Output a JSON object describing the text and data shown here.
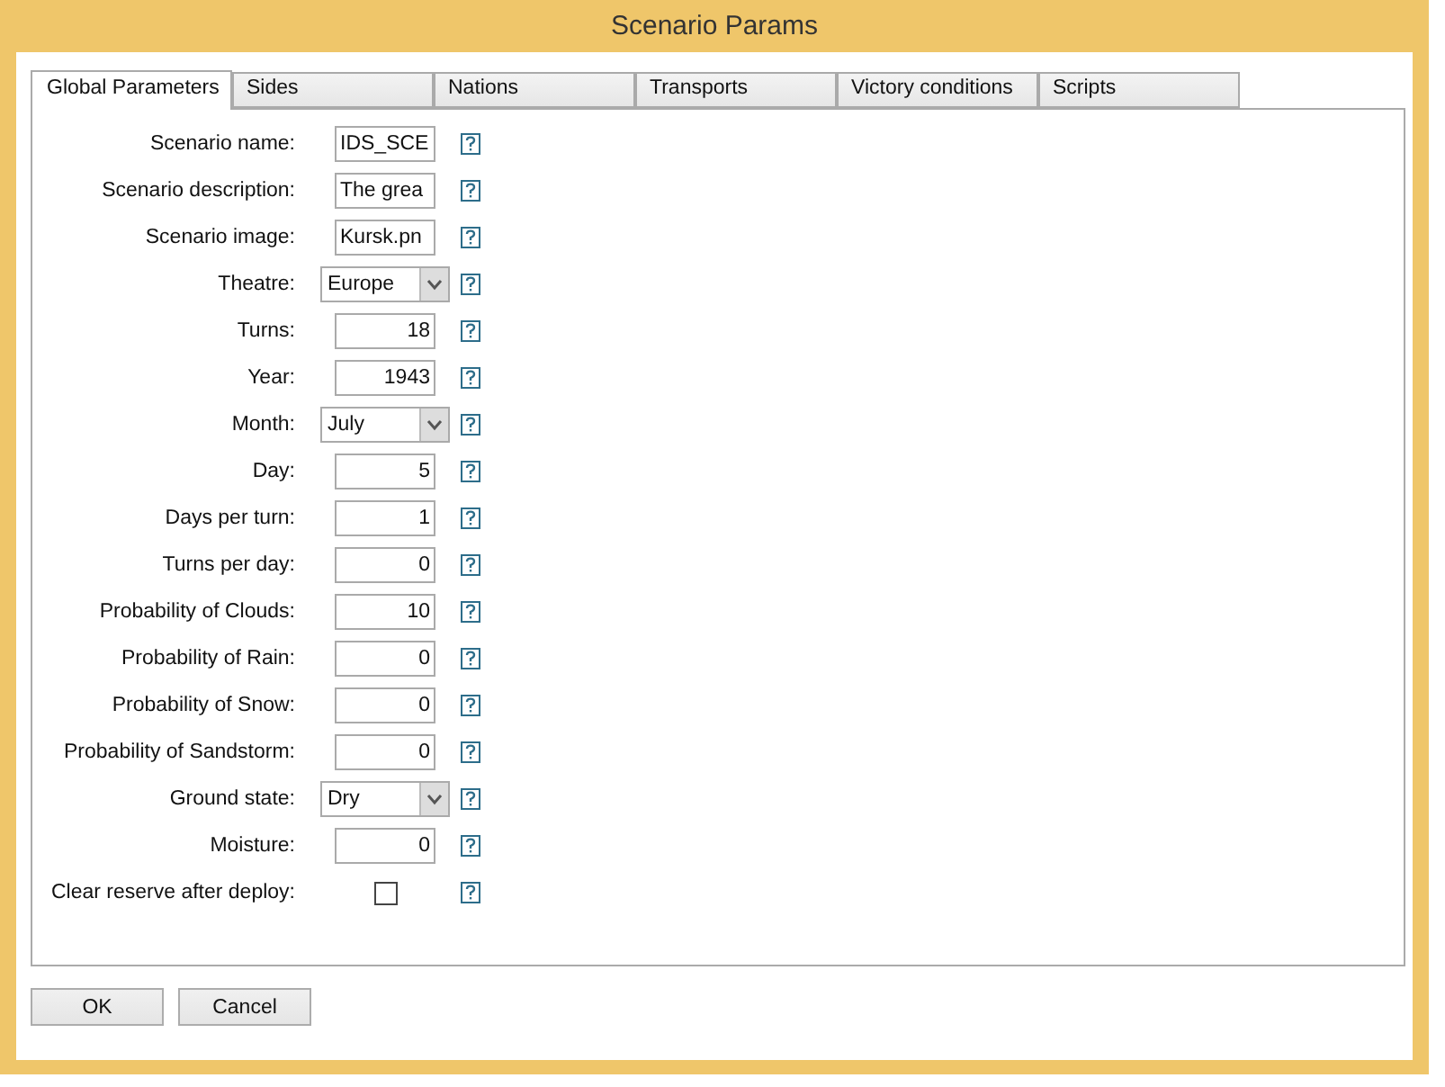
{
  "window": {
    "title": "Scenario Params"
  },
  "tabs": [
    {
      "label": "Global Parameters",
      "selected": true
    },
    {
      "label": "Sides",
      "selected": false
    },
    {
      "label": "Nations",
      "selected": false
    },
    {
      "label": "Transports",
      "selected": false
    },
    {
      "label": "Victory conditions",
      "selected": false
    },
    {
      "label": "Scripts",
      "selected": false
    }
  ],
  "fields": [
    {
      "label": "Scenario name:",
      "kind": "text",
      "value": "IDS_SCE"
    },
    {
      "label": "Scenario description:",
      "kind": "text",
      "value": "The grea"
    },
    {
      "label": "Scenario image:",
      "kind": "text",
      "value": "Kursk.pn"
    },
    {
      "label": "Theatre:",
      "kind": "select",
      "value": "Europe"
    },
    {
      "label": "Turns:",
      "kind": "number",
      "value": "18"
    },
    {
      "label": "Year:",
      "kind": "number",
      "value": "1943"
    },
    {
      "label": "Month:",
      "kind": "select",
      "value": "July"
    },
    {
      "label": "Day:",
      "kind": "number",
      "value": "5"
    },
    {
      "label": "Days per turn:",
      "kind": "number",
      "value": "1"
    },
    {
      "label": "Turns per day:",
      "kind": "number",
      "value": "0"
    },
    {
      "label": "Probability of Clouds:",
      "kind": "number",
      "value": "10"
    },
    {
      "label": "Probability of Rain:",
      "kind": "number",
      "value": "0"
    },
    {
      "label": "Probability of Snow:",
      "kind": "number",
      "value": "0"
    },
    {
      "label": "Probability of Sandstorm:",
      "kind": "number",
      "value": "0"
    },
    {
      "label": "Ground state:",
      "kind": "select",
      "value": "Dry"
    },
    {
      "label": "Moisture:",
      "kind": "number",
      "value": "0"
    },
    {
      "label": "Clear reserve after deploy:",
      "kind": "checkbox",
      "checked": false
    }
  ],
  "buttons": [
    "OK",
    "Cancel"
  ]
}
